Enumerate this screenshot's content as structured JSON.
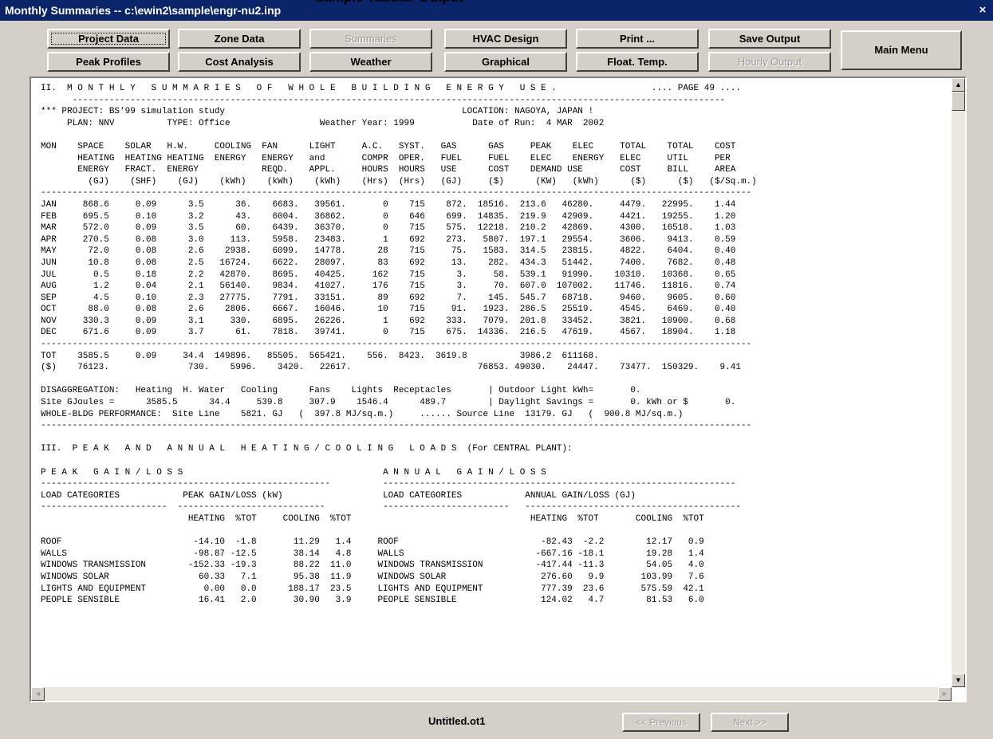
{
  "window": {
    "title": "Monthly Summaries -- c:\\ewin2\\sample\\engr-nu2.inp",
    "caption": "Sample Tabular Output",
    "close_glyph": "×"
  },
  "toolbar": {
    "row1": [
      "Project Data",
      "Zone Data",
      "Summaries",
      "HVAC Design",
      "Print ...",
      "Save Output"
    ],
    "row2": [
      "Peak Profiles",
      "Cost Analysis",
      "Weather",
      "Graphical",
      "Float. Temp.",
      "Hourly Output"
    ],
    "main_menu": "Main Menu"
  },
  "scroll": {
    "up": "▲",
    "down": "▼",
    "left": "◄",
    "right": "►"
  },
  "report": {
    "lines": [
      "II.  M O N T H L Y   S U M M A R I E S   O F   W H O L E   B U I L D I N G   E N E R G Y   U S E .                  .... PAGE 49 ....",
      "      ----------------------------------------------------------------------------------------------------------------------------",
      "*** PROJECT: BS'99 simulation study                                             LOCATION: NAGOYA, JAPAN !",
      "     PLAN: NNV          TYPE: Office                 Weather Year: 1999           Date of Run:  4 MAR  2002",
      "",
      "MON    SPACE    SOLAR   H.W.     COOLING  FAN      LIGHT     A.C.   SYST.   GAS      GAS     PEAK    ELEC     TOTAL    TOTAL    COST",
      "       HEATING  HEATING HEATING  ENERGY   ENERGY   and       COMPR  OPER.   FUEL     FUEL    ELEC    ENERGY   ELEC     UTIL     PER",
      "       ENERGY   FRACT.  ENERGY            REQD.    APPL.     HOURS  HOURS   USE      COST    DEMAND USE       COST     BILL     AREA",
      "         (GJ)    (SHF)    (GJ)    (kWh)    (kWh)    (kWh)    (Hrs)  (Hrs)   (GJ)     ($)      (KW)   (kWh)      ($)      ($)   ($/Sq.m.)",
      "---------------------------------------------------------------------------------------------------------------------------------------",
      "JAN     868.6     0.09      3.5      36.    6683.   39561.       0    715    872.  18516.  213.6   46280.     4479.   22995.    1.44",
      "FEB     695.5     0.10      3.2      43.    6004.   36862.       0    646    699.  14835.  219.9   42909.     4421.   19255.    1.20",
      "MAR     572.0     0.09      3.5      60.    6439.   36370.       0    715    575.  12218.  210.2   42869.     4300.   16518.    1.03",
      "APR     270.5     0.08      3.0     113.    5958.   23483.       1    692    273.   5807.  197.1   29554.     3606.    9413.    0.59",
      "MAY      72.0     0.08      2.6    2938.    6099.   14778.      28    715     75.   1583.  314.5   23815.     4822.    6404.    0.40",
      "JUN      10.8     0.08      2.5   16724.    6622.   28097.      83    692     13.    282.  434.3   51442.     7400.    7682.    0.48",
      "JUL       0.5     0.18      2.2   42870.    8695.   40425.     162    715      3.     58.  539.1   91990.    10310.   10368.    0.65",
      "AUG       1.2     0.04      2.1   56140.    9834.   41027.     176    715      3.     70.  607.0  107002.    11746.   11816.    0.74",
      "SEP       4.5     0.10      2.3   27775.    7791.   33151.      89    692      7.    145.  545.7   68718.     9460.    9605.    0.60",
      "OCT      88.0     0.08      2.6    2806.    6667.   16046.      10    715     91.   1923.  286.5   25519.     4545.    6469.    0.40",
      "NOV     330.3     0.09      3.1     330.    6895.   26226.       1    692    333.   7079.  201.8   33452.     3821.   10900.    0.68",
      "DEC     671.6     0.09      3.7      61.    7818.   39741.       0    715    675.  14336.  216.5   47619.     4567.   18904.    1.18",
      "---------------------------------------------------------------------------------------------------------------------------------------",
      "TOT    3585.5     0.09     34.4  149896.   85505.  565421.    556.  8423.  3619.8          3986.2  611168.",
      "($)    76123.               730.    5996.    3420.   22617.                        76853. 49030.    24447.    73477.  150329.    9.41",
      "",
      "DISAGGREGATION:   Heating  H. Water   Cooling      Fans    Lights  Receptacles       | Outdoor Light kWh=       0.",
      "Site GJoules =      3585.5      34.4     539.8     307.9    1546.4      489.7        | Daylight Savings =       0. kWh or $       0.",
      "WHOLE-BLDG PERFORMANCE:  Site Line    5821. GJ   (  397.8 MJ/sq.m.)     ...... Source Line  13179. GJ   (  900.8 MJ/sq.m.)",
      "---------------------------------------------------------------------------------------------------------------------------------------",
      "",
      "III.  P E A K   A N D   A N N U A L   H E A T I N G / C O O L I N G   L O A D S  (For CENTRAL PLANT):",
      "",
      "P E A K   G A I N / L O S S                                      A N N U A L   G A I N / L O S S",
      "-------------------------------------------------------          -------------------------------------------------------------------",
      "LOAD CATEGORIES            PEAK GAIN/LOSS (kW)                   LOAD CATEGORIES            ANNUAL GAIN/LOSS (GJ)",
      "------------------------  ----------------------------           ------------------------   -----------------------------------------",
      "                            HEATING  %TOT     COOLING  %TOT                                  HEATING  %TOT       COOLING  %TOT",
      "",
      "ROOF                         -14.10  -1.8       11.29   1.4     ROOF                           -82.43  -2.2        12.17   0.9",
      "WALLS                        -98.87 -12.5       38.14   4.8     WALLS                         -667.16 -18.1        19.28   1.4",
      "WINDOWS TRANSMISSION        -152.33 -19.3       88.22  11.0     WINDOWS TRANSMISSION          -417.44 -11.3        54.05   4.0",
      "WINDOWS SOLAR                 60.33   7.1       95.38  11.9     WINDOWS SOLAR                  276.60   9.9       103.99   7.6",
      "LIGHTS AND EQUIPMENT           0.00   0.0      188.17  23.5     LIGHTS AND EQUIPMENT           777.39  23.6       575.59  42.1",
      "PEOPLE SENSIBLE               16.41   2.0       30.90   3.9     PEOPLE SENSIBLE                124.02   4.7        81.53   6.0"
    ]
  },
  "bottom": {
    "filename": "Untitled.ot1",
    "previous": "<< Previous",
    "next": "Next >>"
  }
}
